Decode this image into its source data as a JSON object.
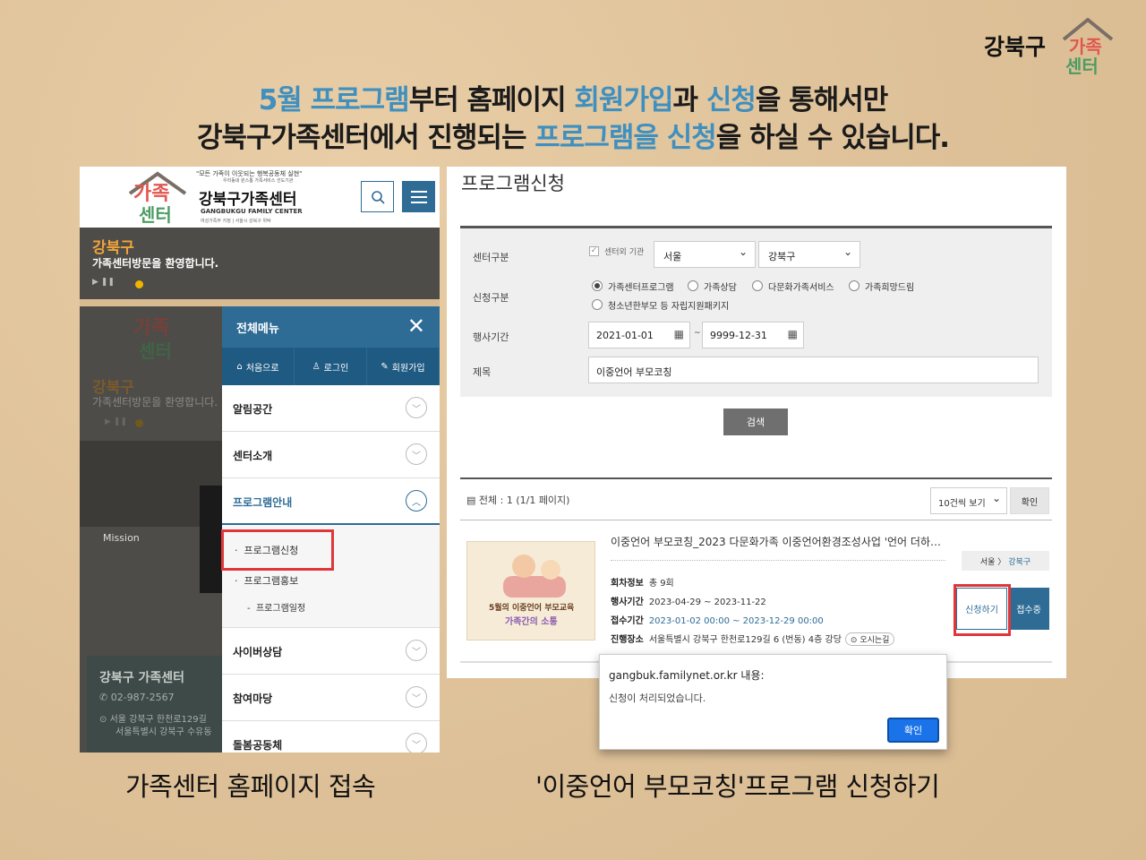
{
  "brand": {
    "name": "강북구",
    "logo_line1": "가족",
    "logo_line2": "센터"
  },
  "headline": {
    "line1_parts": [
      "5월 프로그램",
      "부터 홈페이지 ",
      "회원가입",
      "과 ",
      "신청",
      "을 통해서만"
    ],
    "line2_parts": [
      "강북구가족센터에서 진행되는 ",
      "프로그램을 신청",
      "을 하실 수 있습니다."
    ]
  },
  "left_panel": {
    "slogan": "\"모든 가족이 이웃되는 행복공동체 실현\"",
    "slogan_sub": "우리동네 원스톱 가족서비스 선도기관",
    "center_name": "강북구가족센터",
    "center_eng": "GANGBUKGU FAMILY CENTER",
    "center_tiny": "여성가족부 지정 | 서울시 강북구 위탁",
    "logo_line1": "가족",
    "logo_line2": "센터",
    "hero_title": "강북구",
    "hero_subtitle": "가족센터방문을 환영합니다.",
    "hero_controls": "▶  ❚❚",
    "mission": "Mission",
    "contact_title": "강북구 가족센터",
    "contact_phone": "02-987-2567",
    "contact_addr1": "서울 강북구 한천로129길",
    "contact_addr2": "서울특별시 강북구 수유동",
    "menu": {
      "title": "전체메뉴",
      "nav": [
        "처음으로",
        "로그인",
        "회원가입"
      ],
      "items": [
        "알림공간",
        "센터소개",
        "프로그램안내"
      ],
      "sub_items": [
        "프로그램신청",
        "프로그램홍보",
        "프로그램일정"
      ],
      "items_after": [
        "사이버상담",
        "참여마당",
        "돌봄공동체"
      ]
    },
    "caption": "가족센터 홈페이지 접속"
  },
  "right_panel": {
    "title": "프로그램신청",
    "form": {
      "center_label": "센터구분",
      "outside_label": "센터외 기관",
      "city": "서울",
      "district": "강북구",
      "type_label": "신청구분",
      "radios": [
        "가족센터프로그램",
        "가족상담",
        "다문화가족서비스",
        "가족희망드림",
        "청소년한부모 등 자립지원패키지"
      ],
      "period_label": "행사기간",
      "date_from": "2021-01-01",
      "date_sep": "~",
      "date_to": "9999-12-31",
      "title_label": "제목",
      "title_value": "이중언어 부모코칭",
      "search_button": "검색"
    },
    "list": {
      "total": "전체 : 1 (1/1 페이지)",
      "per_page": "10건씩 보기",
      "confirm": "확인",
      "item_title": "이중언어 부모코칭_2023 다문화가족 이중언어환경조성사업 '언어 더하…",
      "rounds_label": "회차정보",
      "rounds_value": "총 9회",
      "event_period_label": "행사기간",
      "event_period_value": "2023-04-29 ~ 2023-11-22",
      "apply_period_label": "접수기간",
      "apply_period_value": "2023-01-02 00:00 ~ 2023-12-29 00:00",
      "venue_label": "진행장소",
      "venue_value": "서울특별시 강북구 한천로129길 6 (번동) 4층 강당",
      "map_link": "오시는길",
      "region_city": "서울 〉",
      "region_district": "강북구",
      "apply_button": "신청하기",
      "status_button": "접수중",
      "poster_line1": "5월의 이중언어 부모교육",
      "poster_line2": "가족간의 소통"
    },
    "alert": {
      "origin": "gangbuk.familynet.or.kr 내용:",
      "message": "신청이 처리되었습니다.",
      "ok": "확인"
    },
    "caption": "'이중언어 부모코칭'프로그램 신청하기"
  }
}
